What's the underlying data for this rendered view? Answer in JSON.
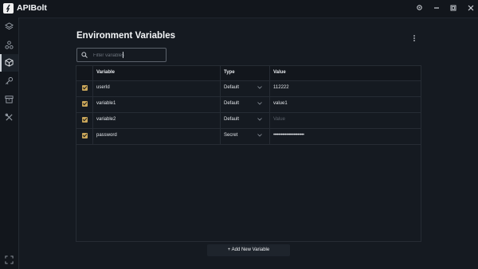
{
  "app": {
    "title": "APIBolt"
  },
  "window_controls": [
    "settings-icon",
    "minimize-icon",
    "maximize-icon",
    "close-icon"
  ],
  "sidebar": {
    "items": [
      {
        "icon": "layers-icon",
        "active": false
      },
      {
        "icon": "network-icon",
        "active": false
      },
      {
        "icon": "cube-icon",
        "active": true
      },
      {
        "icon": "key-icon",
        "active": false
      },
      {
        "icon": "archive-icon",
        "active": false
      },
      {
        "icon": "tools-icon",
        "active": false
      }
    ],
    "bottom_icon": "fullscreen-icon"
  },
  "page": {
    "title": "Environment Variables",
    "filter_placeholder": "Filter variables"
  },
  "table": {
    "columns": {
      "variable": "Variable",
      "type": "Type",
      "value": "Value"
    },
    "rows": [
      {
        "checked": true,
        "variable": "userId",
        "type": "Default",
        "value": "112222"
      },
      {
        "checked": true,
        "variable": "variable1",
        "type": "Default",
        "value": "value1"
      },
      {
        "checked": true,
        "variable": "variable2",
        "type": "Default",
        "value": "",
        "value_placeholder": "Value"
      },
      {
        "checked": true,
        "variable": "password",
        "type": "Secret",
        "value": "••••••••••••••••••••••••"
      }
    ]
  },
  "actions": {
    "add_label": "+  Add New Variable"
  },
  "colors": {
    "background": "#151a21",
    "checkbox": "#c9a65a",
    "border": "#262c34"
  }
}
